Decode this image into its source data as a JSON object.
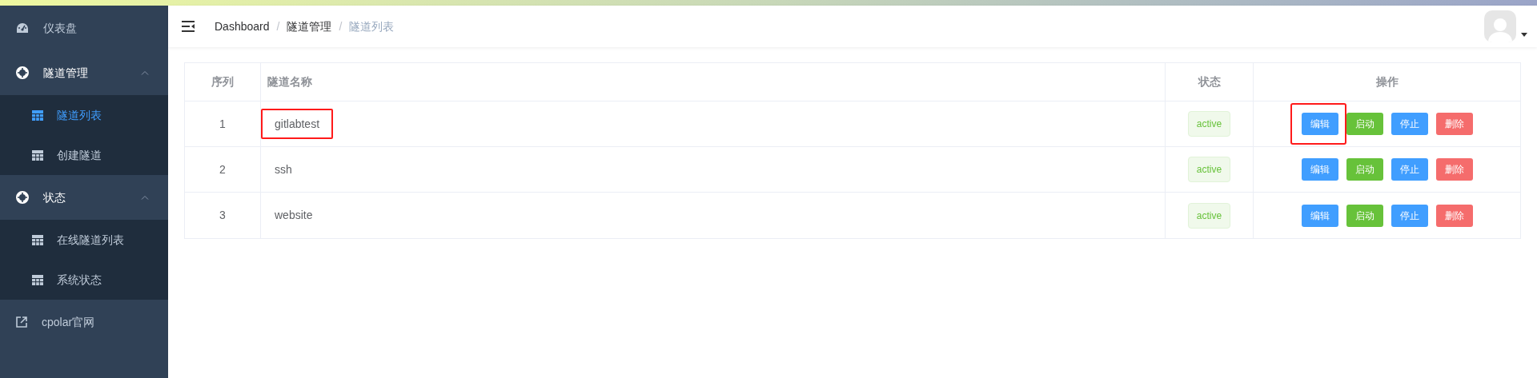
{
  "sidebar": {
    "items": [
      {
        "kind": "dashboard",
        "label": "仪表盘",
        "selected": false
      },
      {
        "kind": "group",
        "label": "隧道管理",
        "expanded": true,
        "children": [
          {
            "label": "隧道列表",
            "selected": true
          },
          {
            "label": "创建隧道",
            "selected": false
          }
        ]
      },
      {
        "kind": "group",
        "label": "状态",
        "expanded": true,
        "children": [
          {
            "label": "在线隧道列表",
            "selected": false
          },
          {
            "label": "系统状态",
            "selected": false
          }
        ]
      },
      {
        "kind": "external",
        "label": "cpolar官网",
        "selected": false
      }
    ]
  },
  "breadcrumb": [
    "Dashboard",
    "隧道管理",
    "隧道列表"
  ],
  "breadcrumb_separator": "/",
  "table": {
    "columns": [
      "序列",
      "隧道名称",
      "状态",
      "操作"
    ],
    "rows": [
      {
        "index": "1",
        "name": "gitlabtest",
        "name_highlighted": true,
        "status": "active",
        "actions": [
          {
            "kind": "edit",
            "label": "编辑",
            "highlighted": true
          },
          {
            "kind": "start",
            "label": "启动",
            "highlighted": false
          },
          {
            "kind": "stop",
            "label": "停止",
            "highlighted": false
          },
          {
            "kind": "delete",
            "label": "删除",
            "highlighted": false
          }
        ]
      },
      {
        "index": "2",
        "name": "ssh",
        "name_highlighted": false,
        "status": "active",
        "actions": [
          {
            "kind": "edit",
            "label": "编辑",
            "highlighted": false
          },
          {
            "kind": "start",
            "label": "启动",
            "highlighted": false
          },
          {
            "kind": "stop",
            "label": "停止",
            "highlighted": false
          },
          {
            "kind": "delete",
            "label": "删除",
            "highlighted": false
          }
        ]
      },
      {
        "index": "3",
        "name": "website",
        "name_highlighted": false,
        "status": "active",
        "actions": [
          {
            "kind": "edit",
            "label": "编辑",
            "highlighted": false
          },
          {
            "kind": "start",
            "label": "启动",
            "highlighted": false
          },
          {
            "kind": "stop",
            "label": "停止",
            "highlighted": false
          },
          {
            "kind": "delete",
            "label": "删除",
            "highlighted": false
          }
        ]
      }
    ]
  }
}
